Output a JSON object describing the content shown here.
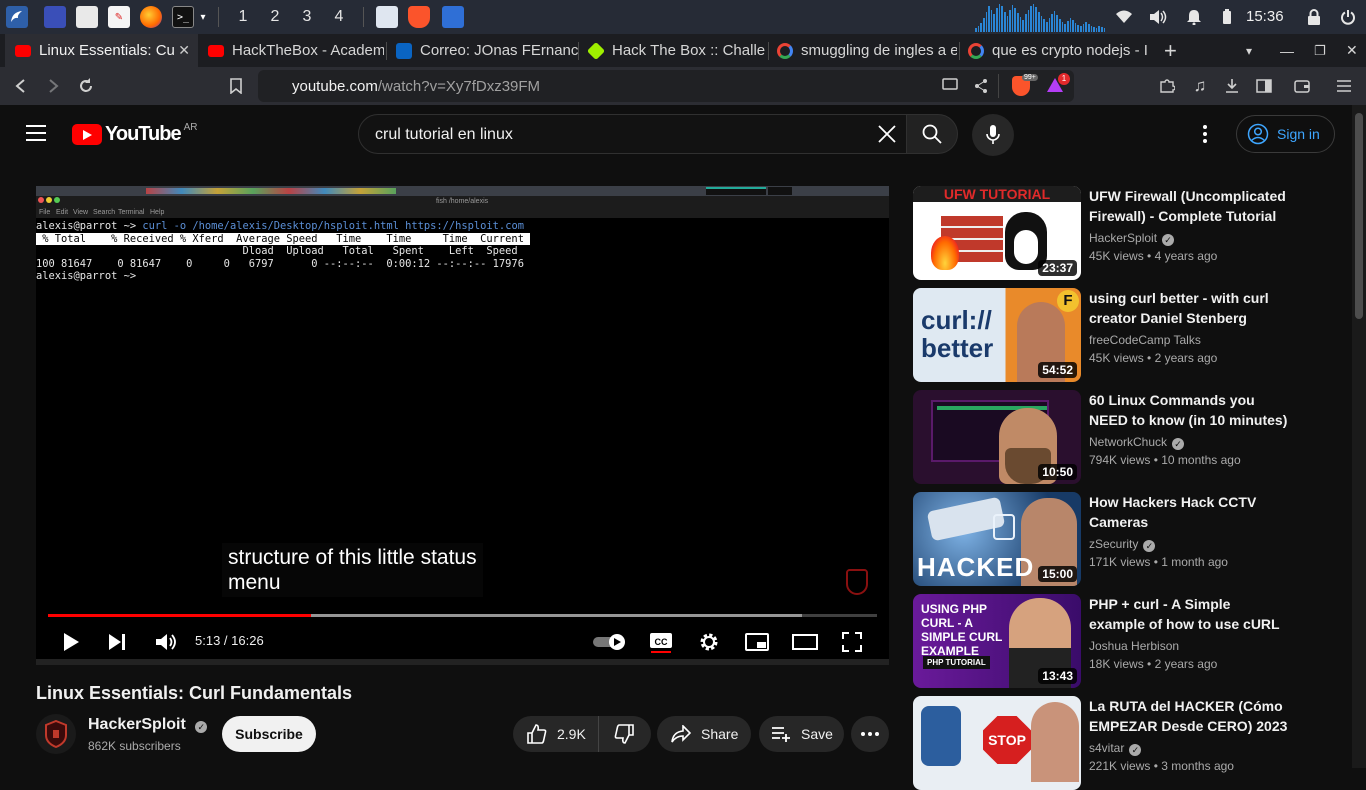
{
  "taskbar": {
    "workspaces": [
      "1",
      "2",
      "3",
      "4"
    ],
    "clock": "15:36"
  },
  "tabs": [
    {
      "label": "Linux Essentials: Cu",
      "active": true,
      "favicon": "youtube"
    },
    {
      "label": "HackTheBox - Academy",
      "favicon": "youtube"
    },
    {
      "label": "Correo: JOnas FErnanc",
      "favicon": "outlook"
    },
    {
      "label": "Hack The Box :: Challen",
      "favicon": "htb"
    },
    {
      "label": "smuggling de ingles a e",
      "favicon": "google"
    },
    {
      "label": "que es crypto nodejs - I",
      "favicon": "google"
    }
  ],
  "address": {
    "domain": "youtube.com",
    "path": "/watch?v=Xy7fDxz39FM",
    "brave_badge": "99+",
    "alert_badge": "1"
  },
  "youtube": {
    "logo_text": "YouTube",
    "region": "AR",
    "search_query": "crul tutorial en linux",
    "sign_in": "Sign in"
  },
  "player": {
    "inner_title": "fish /home/alexis",
    "inner_menu": [
      "File",
      "Edit",
      "View",
      "Search",
      "Terminal",
      "Help"
    ],
    "terminal": {
      "prompt1": "alexis@parrot ~> ",
      "command": "curl -o /home/alexis/Desktop/hsploit.html https://hsploit.com",
      "header1": " % Total    % Received % Xferd  Average Speed   Time    Time     Time  Current ",
      "header2": "                                 Dload  Upload   Total   Spent    Left  Speed",
      "row": "100 81647    0 81647    0     0   6797      0 --:--:--  0:00:12 --:--:-- 17976",
      "prompt2": "alexis@parrot ~> "
    },
    "subtitle_line1": "structure of this little status",
    "subtitle_line2": "menu",
    "current_time": "5:13",
    "duration": "16:26",
    "progress_fraction": 0.317,
    "buffered_fraction": 0.91
  },
  "video": {
    "title": "Linux Essentials: Curl Fundamentals",
    "channel": "HackerSploit",
    "subscribers": "862K subscribers",
    "subscribe_label": "Subscribe",
    "likes": "2.9K",
    "share_label": "Share",
    "save_label": "Save"
  },
  "recommendations": [
    {
      "title": "UFW Firewall (Uncomplicated Firewall) - Complete Tutorial",
      "channel": "HackerSploit",
      "views": "45K views",
      "age": "4 years ago",
      "duration": "23:37",
      "thumb_text": "UFW TUTORIAL"
    },
    {
      "title": "using curl better - with curl creator Daniel Stenberg",
      "channel": "freeCodeCamp Talks",
      "views": "45K views",
      "age": "2 years ago",
      "duration": "54:52",
      "thumb_text": "curl:// better"
    },
    {
      "title": "60 Linux Commands you NEED to know (in 10 minutes)",
      "channel": "NetworkChuck",
      "views": "794K views",
      "age": "10 months ago",
      "duration": "10:50",
      "thumb_text": ""
    },
    {
      "title": "How Hackers Hack CCTV Cameras",
      "channel": "zSecurity",
      "views": "171K views",
      "age": "1 month ago",
      "duration": "15:00",
      "thumb_text": "HACKED"
    },
    {
      "title": "PHP + curl - A Simple example of how to use cURL",
      "channel": "Joshua Herbison",
      "views": "18K views",
      "age": "2 years ago",
      "duration": "13:43",
      "thumb_text": "USING PHP CURL - A SIMPLE CURL EXAMPLE",
      "thumb_sub": "PHP TUTORIAL"
    },
    {
      "title": "La RUTA del HACKER (Cómo EMPEZAR Desde CERO) 2023",
      "channel": "s4vitar",
      "views": "221K views",
      "age": "3 months ago",
      "duration": "",
      "thumb_text": "STOP"
    }
  ],
  "colors": {
    "yt_red": "#ff0000",
    "link_blue": "#3ea6ff",
    "taskbar": "#262b36",
    "tab_bar": "#1c1d21"
  }
}
